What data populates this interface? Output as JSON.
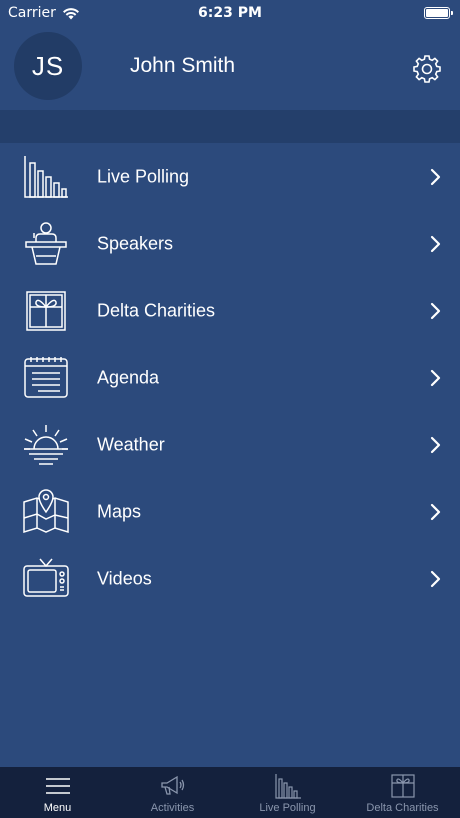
{
  "status_bar": {
    "carrier": "Carrier",
    "time": "6:23 PM",
    "wifi_icon": "wifi-icon",
    "battery_icon": "battery-icon",
    "battery_level": 1.0
  },
  "profile": {
    "initials": "JS",
    "name": "John Smith",
    "settings_icon": "gear-icon"
  },
  "menu": {
    "items": [
      {
        "label": "Live Polling",
        "icon": "bar-chart-icon"
      },
      {
        "label": "Speakers",
        "icon": "podium-speaker-icon"
      },
      {
        "label": "Delta Charities",
        "icon": "gift-box-icon"
      },
      {
        "label": "Agenda",
        "icon": "calendar-notepad-icon"
      },
      {
        "label": "Weather",
        "icon": "sunrise-icon"
      },
      {
        "label": "Maps",
        "icon": "map-pin-icon"
      },
      {
        "label": "Videos",
        "icon": "television-icon"
      }
    ]
  },
  "tab_bar": {
    "tabs": [
      {
        "label": "Menu",
        "icon": "hamburger-menu-icon",
        "active": true
      },
      {
        "label": "Activities",
        "icon": "megaphone-icon",
        "active": false
      },
      {
        "label": "Live Polling",
        "icon": "bar-chart-icon",
        "active": false
      },
      {
        "label": "Delta Charities",
        "icon": "gift-box-icon",
        "active": false
      }
    ]
  },
  "colors": {
    "background": "#2c4a7c",
    "band": "#243f6b",
    "avatar": "#223c66",
    "tab_bar": "#14213d",
    "tab_inactive": "#8a96ad",
    "text": "#ffffff"
  }
}
